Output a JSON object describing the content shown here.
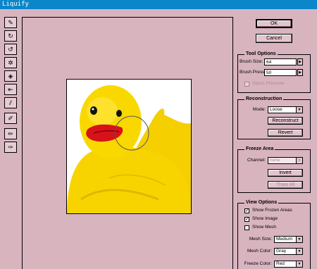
{
  "window": {
    "title": "Liquify"
  },
  "toolbar": {
    "tools": [
      {
        "name": "warp-tool",
        "glyph": "✎"
      },
      {
        "name": "twirl-clockwise-tool",
        "glyph": "↻"
      },
      {
        "name": "twirl-counterclockwise-tool",
        "glyph": "↺"
      },
      {
        "name": "pucker-tool",
        "glyph": "✲"
      },
      {
        "name": "bloat-tool",
        "glyph": "◈"
      },
      {
        "name": "shift-pixels-tool",
        "glyph": "⇤"
      },
      {
        "name": "reflection-tool",
        "glyph": "⫽"
      },
      {
        "name": "reconstruct-tool",
        "glyph": "✐"
      },
      {
        "name": "freeze-tool",
        "glyph": "✏"
      },
      {
        "name": "thaw-tool",
        "glyph": "✑"
      }
    ]
  },
  "buttons": {
    "ok": "OK",
    "cancel": "Cancel"
  },
  "tool_options": {
    "title": "Tool Options",
    "brush_size_label": "Brush Size:",
    "brush_size_value": "64",
    "brush_pressure_label": "Brush Pressure:",
    "brush_pressure_value": "50",
    "stylus_pressure_label": "Stylus Pressure",
    "stylus_pressure_checked": false
  },
  "reconstruction": {
    "title": "Reconstruction",
    "mode_label": "Mode:",
    "mode_value": "Loose",
    "reconstruct_label": "Reconstruct",
    "revert_label": "Revert"
  },
  "freeze_area": {
    "title": "Freeze Area",
    "channel_label": "Channel:",
    "channel_value": "none",
    "invert_label": "Invert",
    "thaw_all_label": "Thaw All"
  },
  "view_options": {
    "title": "View Options",
    "show_frozen_areas_label": "Show Frozen Areas",
    "show_frozen_areas_checked": true,
    "show_image_label": "Show Image",
    "show_image_checked": true,
    "show_mesh_label": "Show Mesh",
    "show_mesh_checked": false,
    "mesh_size_label": "Mesh Size:",
    "mesh_size_value": "Medium",
    "mesh_color_label": "Mesh Color:",
    "mesh_color_value": "Gray",
    "freeze_color_label": "Freeze Color:",
    "freeze_color_value": "Red"
  },
  "colors": {
    "background": "#d8b4bf",
    "titlebar": "#0a86c9",
    "duck_yellow": "#f7d400",
    "beak_red": "#d8121b"
  }
}
